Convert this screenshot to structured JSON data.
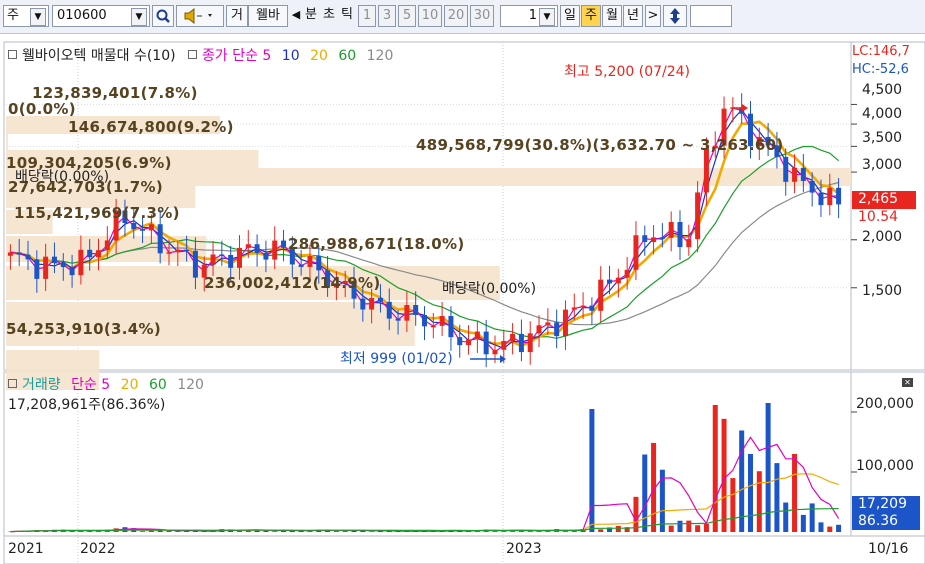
{
  "toolbar": {
    "type_label": "주",
    "code": "010600",
    "buttons": [
      "거",
      "웰바"
    ],
    "periods": [
      "분",
      "초",
      "틱",
      "1",
      "3",
      "5",
      "10",
      "20",
      "30"
    ],
    "count": "1",
    "timeframes": [
      "일",
      "주",
      "월",
      "년"
    ],
    "selected_timeframe": "주"
  },
  "price_panel": {
    "legend_name": "웰바이오텍 매물대 수(10)",
    "legend_close": "종가 단순 5",
    "legend_ma": [
      "10",
      "20",
      "60",
      "120"
    ],
    "lc_label": "LC:146,7",
    "hc_label": "HC:-52,6",
    "current_price": "2,465",
    "current_change": "10.54",
    "high_label": "최고 5,200 (07/24)",
    "low_label": "최저 999 (01/02)",
    "dividend_labels": [
      "배당락(0.00%)",
      "배당락(0.00%)"
    ]
  },
  "volume_profile": [
    {
      "label": "123,839,401(7.8%)"
    },
    {
      "label": "0(0.0%)"
    },
    {
      "label": "146,674,800(9.2%)"
    },
    {
      "label": "489,568,799(30.8%)(3,632.70 ~ 3,263.60)"
    },
    {
      "label": "109,304,205(6.9%)"
    },
    {
      "label": "27,642,703(1.7%)"
    },
    {
      "label": "115,421,969(7.3%)"
    },
    {
      "label": "286,988,671(18.0%)"
    },
    {
      "label": "236,002,412(14.9%)"
    },
    {
      "label": "54,253,910(3.4%)"
    }
  ],
  "volume_panel": {
    "legend_name": "거래량",
    "legend_ma": "단순 5",
    "legend_periods": [
      "20",
      "60",
      "120"
    ],
    "info": "17,208,961주(86.36%)",
    "current_value": "17,209",
    "current_pct": "86.36"
  },
  "axes": {
    "price_ticks": [
      "4,500",
      "4,000",
      "3,500",
      "3,000",
      "2,000",
      "1,500"
    ],
    "volume_ticks": [
      "200,000",
      "100,000"
    ],
    "date_labels": [
      "2021",
      "2022",
      "2023"
    ],
    "last_date": "10/16"
  },
  "colors": {
    "up": "#e8261f",
    "down": "#1c55c8",
    "ma5": "#e000c8",
    "ma10": "#1d2fc8",
    "ma20": "#f2a900",
    "ma60": "#1c9e2a",
    "ma120": "#8a8a8a",
    "profile": "#f5e3cc"
  },
  "chart_data": {
    "type": "candlestick",
    "timeframe": "weekly",
    "y_scale": "log",
    "ylim": [
      950,
      5400
    ],
    "x": [
      "2021-12",
      "2022-01",
      "2022-02",
      "2022-03",
      "2022-04",
      "2022-05",
      "2022-06",
      "2022-07",
      "2022-08",
      "2022-09",
      "2022-10",
      "2022-11",
      "2022-12",
      "2023-01",
      "2023-02",
      "2023-03",
      "2023-04",
      "2023-05",
      "2023-06",
      "2023-07",
      "2023-08",
      "2023-09",
      "2023-10"
    ],
    "close": [
      1800,
      1700,
      1750,
      2300,
      1950,
      1700,
      1850,
      1900,
      1700,
      1450,
      1300,
      1250,
      1100,
      1050,
      1150,
      1300,
      1550,
      2100,
      2000,
      4500,
      3500,
      2800,
      2465
    ],
    "volume": [
      2000,
      4000,
      3000,
      8000,
      3000,
      2000,
      5000,
      3000,
      4000,
      3000,
      2000,
      2000,
      3000,
      4000,
      3000,
      5000,
      10000,
      150000,
      20000,
      215000,
      130000,
      50000,
      17209
    ]
  }
}
